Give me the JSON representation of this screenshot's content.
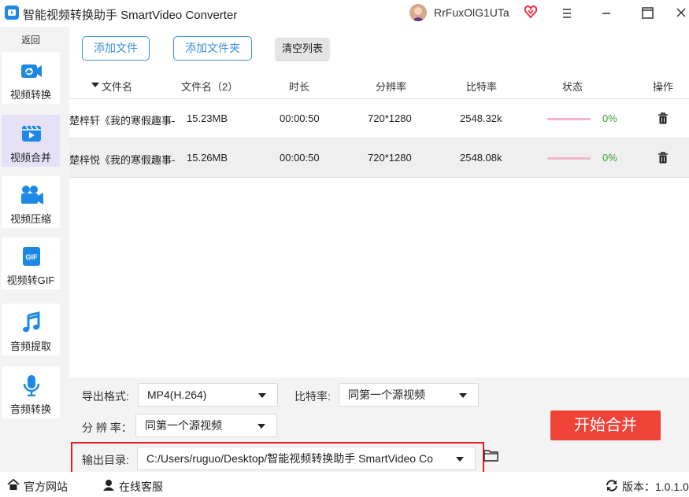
{
  "app": {
    "title": "智能视频转换助手 SmartVideo Converter",
    "user": "RrFuxOlG1UTa"
  },
  "sidebar": {
    "back": "返回",
    "items": [
      {
        "label": "视频转换",
        "icon": "video-convert-icon"
      },
      {
        "label": "视频合并",
        "icon": "video-merge-icon",
        "active": true
      },
      {
        "label": "视频压缩",
        "icon": "video-compress-icon"
      },
      {
        "label": "视频转GIF",
        "icon": "gif-icon"
      },
      {
        "label": "音频提取",
        "icon": "music-note-icon"
      },
      {
        "label": "音频转换",
        "icon": "microphone-icon"
      }
    ]
  },
  "toolbar": {
    "add_file": "添加文件",
    "add_folder": "添加文件夹",
    "clear_list": "清空列表"
  },
  "table": {
    "headers": [
      "文件名",
      "文件名（2）",
      "时长",
      "分辨率",
      "比特率",
      "状态",
      "操作"
    ],
    "rows": [
      {
        "name": "楚梓轩《我的寒假趣事-",
        "size": "15.23MB",
        "duration": "00:00:50",
        "resolution": "720*1280",
        "bitrate": "2548.32k",
        "progress": "0%"
      },
      {
        "name": "楚梓悦《我的寒假趣事-",
        "size": "15.26MB",
        "duration": "00:00:50",
        "resolution": "720*1280",
        "bitrate": "2548.08k",
        "progress": "0%"
      }
    ]
  },
  "settings": {
    "format_label": "导出格式:",
    "format_value": "MP4(H.264)",
    "bitrate_label": "比特率:",
    "bitrate_value": "同第一个源视频",
    "resolution_label": "分 辨 率：",
    "resolution_value": "同第一个源视频",
    "output_label": "输出目录:",
    "output_value": "C:/Users/ruguo/Desktop/智能视频转换助手 SmartVideo Co",
    "start": "开始合并"
  },
  "footer": {
    "website": "官方网站",
    "support": "在线客服",
    "version": "版本：1.0.1.0"
  },
  "colors": {
    "accent": "#3b8fd9",
    "start_button": "#f04338",
    "progress_text": "#33a532",
    "highlight_border": "#e61e1e"
  }
}
